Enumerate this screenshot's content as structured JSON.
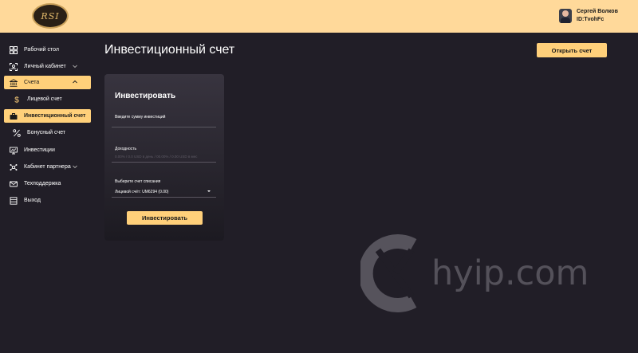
{
  "header": {
    "logo_text": "RSI",
    "user_name": "Сергей Волков",
    "user_id": "ID:TvohFc",
    "bg_color": "#ffd99a"
  },
  "sidebar": {
    "items": [
      {
        "label": "Рабочий стол",
        "icon": "dashboard-icon"
      },
      {
        "label": "Личный кабинет",
        "icon": "user-cabinet-icon",
        "chevron": "down"
      },
      {
        "label": "Счета",
        "icon": "bank-icon",
        "chevron": "up",
        "active": true
      },
      {
        "label": "Лицевой счет",
        "icon": "dollar-icon"
      },
      {
        "label": "Инвестиционный счет",
        "icon": "briefcase-icon",
        "active": true
      },
      {
        "label": "Бонусный счет",
        "icon": "percent-icon"
      },
      {
        "label": "Инвестиции",
        "icon": "monitor-icon"
      },
      {
        "label": "Кабинет партнера",
        "icon": "partner-icon",
        "chevron": "down"
      },
      {
        "label": "Техподдержка",
        "icon": "support-icon"
      },
      {
        "label": "Выход",
        "icon": "logout-icon"
      }
    ]
  },
  "main": {
    "title": "Инвестиционный счет",
    "open_account_label": "Открыть счет",
    "card": {
      "title": "Инвестировать",
      "amount_label": "Введите сумму инвестиций",
      "yield_label": "Доходность",
      "yield_sub": "0.00% / 0.0 USD в день / 00.00% / 0.00 USD в мес",
      "account_label": "Выберите счет списания",
      "account_value": "Лицевой счёт: UM6294 (0.00)",
      "invest_label": "Инвестировать"
    }
  },
  "watermark": {
    "text": "hyip.com",
    "icon": "hyip-logo-icon"
  },
  "colors": {
    "accent": "#ffd07a",
    "background": "#211e27",
    "card_top": "#38343f",
    "card_bottom": "#1c1a21"
  }
}
